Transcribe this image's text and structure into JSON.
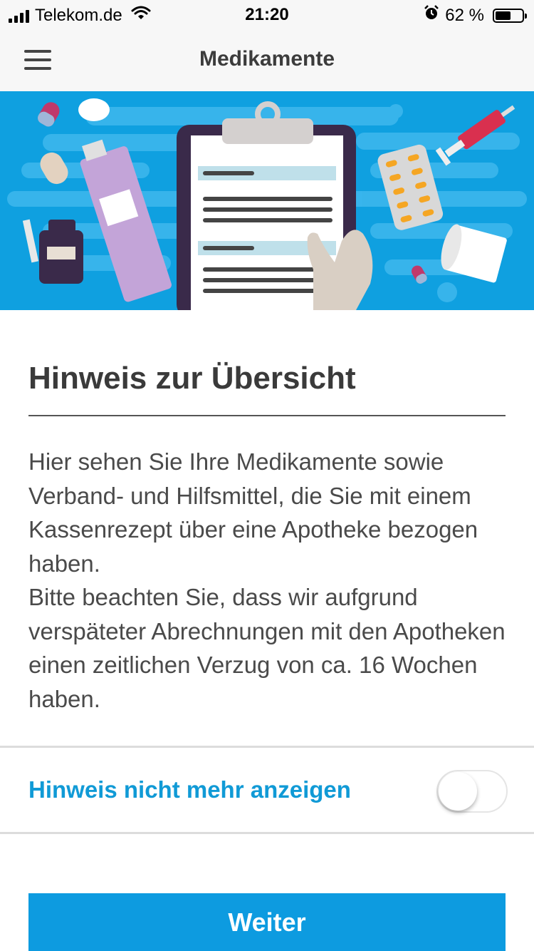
{
  "status_bar": {
    "carrier": "Telekom.de",
    "time": "21:20",
    "battery_percent": "62 %",
    "battery_level": 0.62,
    "icons": [
      "signal-icon",
      "wifi-icon",
      "alarm-icon",
      "battery-icon"
    ]
  },
  "nav": {
    "title": "Medikamente",
    "menu_icon": "hamburger-menu-icon"
  },
  "banner": {
    "illustration": "clipboard-with-medications-illustration",
    "background_color": "#0fa0e0"
  },
  "content": {
    "heading": "Hinweis zur Übersicht",
    "paragraph_1": "Hier sehen Sie Ihre Medikamente sowie Verband- und Hilfsmittel, die Sie mit einem Kassenrezept über eine Apotheke bezogen haben.",
    "paragraph_2": "Bitte beachten Sie, dass wir aufgrund verspäteter Abrechnungen mit den Apotheken einen zeitlichen Verzug von ca. 16 Wochen haben."
  },
  "toggle": {
    "label": "Hinweis nicht mehr anzeigen",
    "value": false
  },
  "button": {
    "label": "Weiter"
  },
  "colors": {
    "accent": "#0d9be0",
    "link_blue": "#109ad6",
    "text": "#4a4a4a"
  }
}
